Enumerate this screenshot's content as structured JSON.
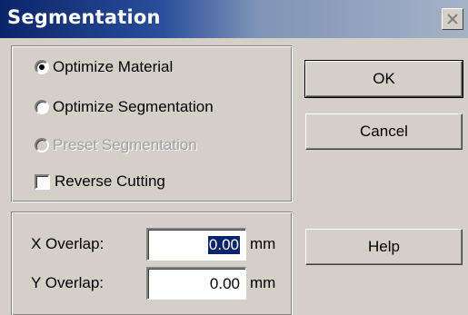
{
  "window": {
    "title": "Segmentation"
  },
  "options": {
    "optimize_material": {
      "label": "Optimize Material",
      "checked": true,
      "enabled": true
    },
    "optimize_segmentation": {
      "label": "Optimize Segmentation",
      "checked": false,
      "enabled": true
    },
    "preset_segmentation": {
      "label": "Preset Segmentation",
      "checked": false,
      "enabled": false
    },
    "reverse_cutting": {
      "label": "Reverse Cutting",
      "checked": false
    }
  },
  "overlap": {
    "x_label": "X Overlap:",
    "x_value": "0.00",
    "x_unit": "mm",
    "y_label": "Y Overlap:",
    "y_value": "0.00",
    "y_unit": "mm"
  },
  "buttons": {
    "ok": "OK",
    "cancel": "Cancel",
    "help": "Help"
  },
  "colors": {
    "title_bar": "#0a246a",
    "face": "#d4d0c8",
    "selection": "#0a246a"
  },
  "icons": {
    "close": "close-icon"
  }
}
